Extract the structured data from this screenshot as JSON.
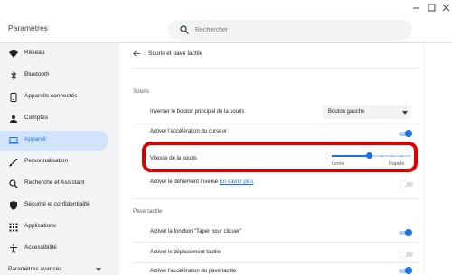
{
  "header": {
    "app_title": "Paramètres",
    "search_placeholder": "Rechercher"
  },
  "window_controls": [
    "minimize-icon",
    "maximize-icon",
    "close-icon"
  ],
  "sidebar": {
    "items": [
      {
        "label": "Réseau",
        "icon": "wifi-icon",
        "active": false
      },
      {
        "label": "Bluetooth",
        "icon": "bluetooth-icon",
        "active": false
      },
      {
        "label": "Appareils connectés",
        "icon": "connected-devices-icon",
        "active": false
      },
      {
        "label": "Comptes",
        "icon": "person-icon",
        "active": false
      },
      {
        "label": "Appareil",
        "icon": "laptop-icon",
        "active": true
      },
      {
        "label": "Personnalisation",
        "icon": "brush-icon",
        "active": false
      },
      {
        "label": "Recherche et Assistant",
        "icon": "search-icon",
        "active": false
      },
      {
        "label": "Sécurité et confidentialité",
        "icon": "shield-icon",
        "active": false
      },
      {
        "label": "Applications",
        "icon": "apps-grid-icon",
        "active": false
      },
      {
        "label": "Accessibilité",
        "icon": "accessibility-icon",
        "active": false
      }
    ],
    "advanced_label": "Paramètres avancés"
  },
  "page": {
    "title": "Souris et pavé tactile",
    "mouse_section": {
      "title": "Souris",
      "primary_button": {
        "label": "Inverser le bouton principal de la souris",
        "value": "Bouton gauche"
      },
      "acceleration": {
        "label": "Activer l'accélération du curseur",
        "on": true
      },
      "speed": {
        "label": "Vitesse de la souris",
        "slow_label": "Lente",
        "fast_label": "Rapide",
        "level": 0.47
      },
      "reverse_scroll": {
        "label": "Activer le défilement inversé",
        "link": "En savoir plus",
        "on": false
      }
    },
    "touchpad_section": {
      "title": "Pavé tactile",
      "tap_to_click": {
        "label": "Activer la fonction \"Taper pour cliquer\"",
        "on": true
      },
      "tap_drag": {
        "label": "Activer le déplacement tactile",
        "on": false
      },
      "touchpad_accel": {
        "label": "Activer l'accélération du pavé tactile",
        "on": true
      }
    }
  },
  "colors": {
    "accent": "#1a73e8",
    "highlight": "#e00000",
    "sidebar_bg": "#f1f3f4",
    "active_bg": "#d2e3fc"
  }
}
